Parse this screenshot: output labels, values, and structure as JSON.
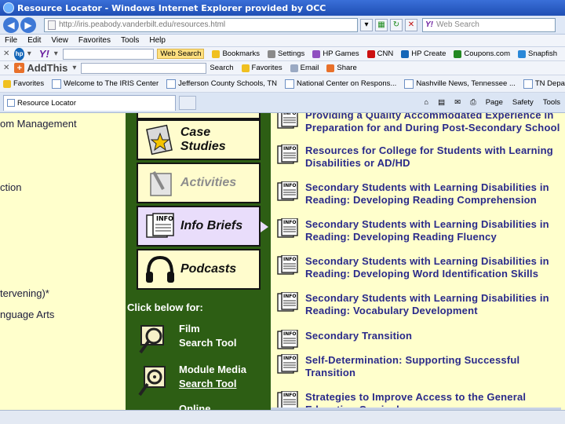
{
  "window": {
    "title": "Resource Locator - Windows Internet Explorer provided by OCC"
  },
  "address_bar": {
    "url": "http://iris.peabody.vanderbilt.edu/resources.html",
    "search_placeholder": "Web Search"
  },
  "menu": [
    "File",
    "Edit",
    "View",
    "Favorites",
    "Tools",
    "Help"
  ],
  "toolbar_hp_yahoo": {
    "search_label": "Web Search",
    "items": [
      "Bookmarks",
      "Settings",
      "HP Games",
      "CNN",
      "HP Create",
      "Coupons.com",
      "Snapfish"
    ]
  },
  "toolbar_addthis": {
    "addthis_label": "AddThis",
    "items": [
      "Search",
      "Favorites",
      "Email",
      "Share"
    ]
  },
  "favorites_bar": {
    "favorites_label": "Favorites",
    "items": [
      "Welcome to The IRIS Center",
      "Jefferson County Schools, TN",
      "National Center on Respons...",
      "Nashville News, Tennessee ...",
      "TN Department of Education"
    ]
  },
  "tabbar": {
    "tab_title": "Resource Locator",
    "tools": [
      "Page",
      "Safety",
      "Tools"
    ]
  },
  "left_column": {
    "items": [
      "om Management",
      "ction",
      "tervening)*",
      "nguage Arts"
    ]
  },
  "middle_column": {
    "tiles": [
      {
        "label": "Case Studies",
        "icon": "star-notebook-icon"
      },
      {
        "label": "Activities",
        "icon": "pencil-paper-icon"
      },
      {
        "label": "Info Briefs",
        "icon": "info-brief-icon"
      },
      {
        "label": "Podcasts",
        "icon": "headphones-icon"
      }
    ],
    "click_below": "Click below for:",
    "tools": [
      {
        "line1": "Film",
        "line2": "Search Tool"
      },
      {
        "line1": "Module Media",
        "line2": "Search Tool"
      },
      {
        "line1": "Online",
        "line2": ""
      }
    ]
  },
  "info_briefs": [
    {
      "line1": "Providing a Quality Accommodated Experience in",
      "line2": "Preparation for and During Post-Secondary School"
    },
    {
      "line1": "Resources for College for Students with Learning",
      "line2": "Disabilities or AD/HD"
    },
    {
      "line1": "Secondary Students with Learning Disabilities in",
      "line2": "Reading: Developing Reading Comprehension"
    },
    {
      "line1": "Secondary Students with Learning Disabilities in",
      "line2": "Reading: Developing Reading Fluency"
    },
    {
      "line1": "Secondary Students with Learning Disabilities in",
      "line2": "Reading: Developing Word Identification Skills"
    },
    {
      "line1": "Secondary Students with Learning Disabilities in",
      "line2": "Reading: Vocabulary Development"
    },
    {
      "line1": "Secondary Transition",
      "line2": ""
    },
    {
      "line1": "Self-Determination: Supporting Successful",
      "line2": "Transition"
    },
    {
      "line1": "Strategies to Improve Access to the General",
      "line2": "Education Curriculum"
    }
  ],
  "colors": {
    "titlebar": "#1f4fb4",
    "page_bg": "#ffffcc",
    "green_panel": "#2d5e14",
    "link_text": "#2a2a8a",
    "active_tile": "#e9ddfb"
  }
}
